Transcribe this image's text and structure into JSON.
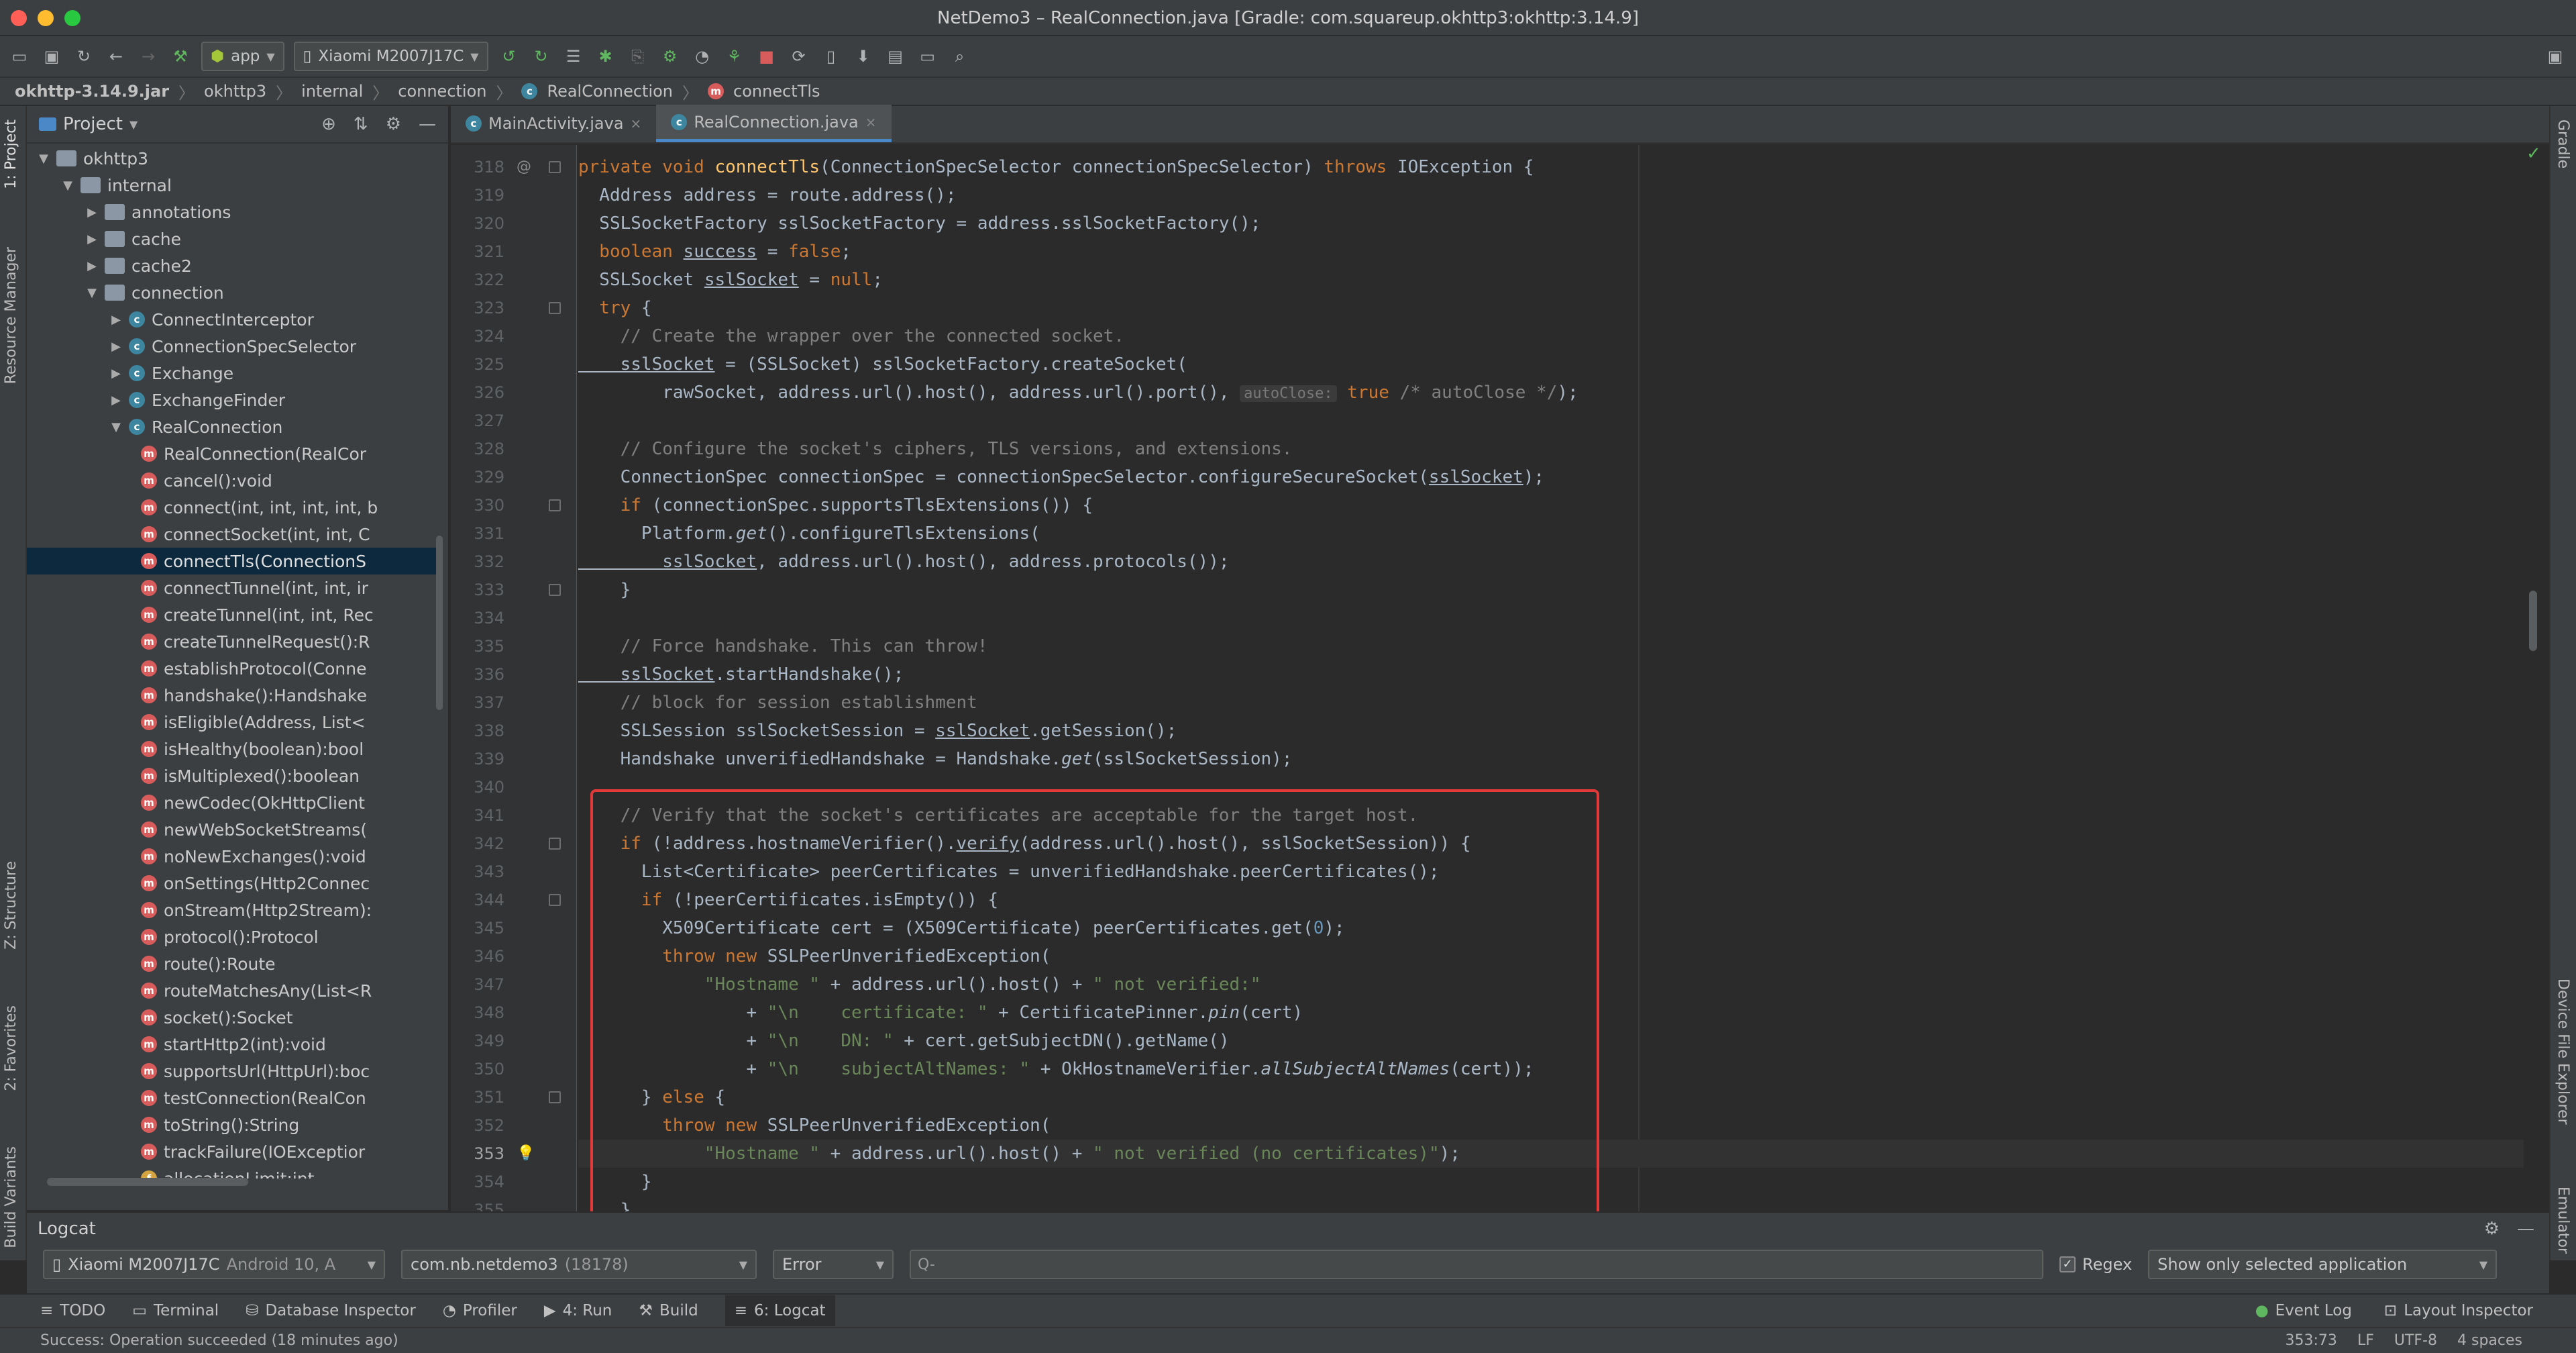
{
  "window": {
    "title": "NetDemo3 – RealConnection.java [Gradle: com.squareup.okhttp3:okhttp:3.14.9]",
    "colors": {
      "close": "#ff5f57",
      "minimize": "#febc2e",
      "maximize": "#28c840",
      "selection_box": "#e23a3a"
    }
  },
  "toolbar": {
    "run_config": "app",
    "device": "Xiaomi M2007J17C"
  },
  "breadcrumb": [
    "okhttp-3.14.9.jar",
    "okhttp3",
    "internal",
    "connection",
    "RealConnection",
    "connectTls"
  ],
  "project": {
    "title": "Project",
    "tree": [
      {
        "label": "okhttp3",
        "kind": "folder",
        "level": 1,
        "expanded": true
      },
      {
        "label": "internal",
        "kind": "folder",
        "level": 2,
        "expanded": true
      },
      {
        "label": "annotations",
        "kind": "folder",
        "level": 3,
        "expanded": false
      },
      {
        "label": "cache",
        "kind": "folder",
        "level": 3,
        "expanded": false
      },
      {
        "label": "cache2",
        "kind": "folder",
        "level": 3,
        "expanded": false
      },
      {
        "label": "connection",
        "kind": "folder",
        "level": 3,
        "expanded": true
      },
      {
        "label": "ConnectInterceptor",
        "kind": "class",
        "level": 4,
        "expanded": false
      },
      {
        "label": "ConnectionSpecSelector",
        "kind": "class",
        "level": 4,
        "expanded": false
      },
      {
        "label": "Exchange",
        "kind": "class",
        "level": 4,
        "expanded": false
      },
      {
        "label": "ExchangeFinder",
        "kind": "class",
        "level": 4,
        "expanded": false
      },
      {
        "label": "RealConnection",
        "kind": "class",
        "level": 4,
        "expanded": true
      },
      {
        "label": "RealConnection(RealCor",
        "kind": "method",
        "level": 5
      },
      {
        "label": "cancel():void",
        "kind": "method",
        "level": 5
      },
      {
        "label": "connect(int, int, int, int, b",
        "kind": "method",
        "level": 5
      },
      {
        "label": "connectSocket(int, int, C",
        "kind": "method",
        "level": 5
      },
      {
        "label": "connectTls(ConnectionS",
        "kind": "method",
        "level": 5,
        "selected": true
      },
      {
        "label": "connectTunnel(int, int, ir",
        "kind": "method",
        "level": 5
      },
      {
        "label": "createTunnel(int, int, Rec",
        "kind": "method",
        "level": 5
      },
      {
        "label": "createTunnelRequest():R",
        "kind": "method",
        "level": 5
      },
      {
        "label": "establishProtocol(Conne",
        "kind": "method",
        "level": 5
      },
      {
        "label": "handshake():Handshake",
        "kind": "method",
        "level": 5
      },
      {
        "label": "isEligible(Address, List<",
        "kind": "method",
        "level": 5
      },
      {
        "label": "isHealthy(boolean):bool",
        "kind": "method",
        "level": 5
      },
      {
        "label": "isMultiplexed():boolean",
        "kind": "method",
        "level": 5
      },
      {
        "label": "newCodec(OkHttpClient",
        "kind": "method",
        "level": 5
      },
      {
        "label": "newWebSocketStreams(",
        "kind": "method",
        "level": 5
      },
      {
        "label": "noNewExchanges():void",
        "kind": "method",
        "level": 5
      },
      {
        "label": "onSettings(Http2Connec",
        "kind": "method",
        "level": 5
      },
      {
        "label": "onStream(Http2Stream):",
        "kind": "method",
        "level": 5
      },
      {
        "label": "protocol():Protocol",
        "kind": "method",
        "level": 5
      },
      {
        "label": "route():Route",
        "kind": "method",
        "level": 5
      },
      {
        "label": "routeMatchesAny(List<R",
        "kind": "method",
        "level": 5
      },
      {
        "label": "socket():Socket",
        "kind": "method",
        "level": 5
      },
      {
        "label": "startHttp2(int):void",
        "kind": "method",
        "level": 5
      },
      {
        "label": "supportsUrl(HttpUrl):boc",
        "kind": "method",
        "level": 5
      },
      {
        "label": "testConnection(RealCon",
        "kind": "method",
        "level": 5
      },
      {
        "label": "toString():String",
        "kind": "method",
        "level": 5
      },
      {
        "label": "trackFailure(IOExceptior",
        "kind": "method",
        "level": 5
      },
      {
        "label": "allocationLimit:int",
        "kind": "field",
        "level": 5
      }
    ]
  },
  "editor": {
    "tabs": [
      {
        "label": "MainActivity.java",
        "active": false
      },
      {
        "label": "RealConnection.java",
        "active": true
      }
    ],
    "current_line": "353",
    "lines": [
      {
        "n": "318",
        "t": [
          [
            "kw",
            "private void "
          ],
          [
            "fn",
            "connectTls"
          ],
          [
            "",
            "(ConnectionSpecSelector connectionSpecSelector) "
          ],
          [
            "kw",
            "throws "
          ],
          [
            "",
            "IOException {"
          ]
        ],
        "mark": "@",
        "fold": true
      },
      {
        "n": "319",
        "t": [
          [
            "",
            "  Address address = route.address();"
          ]
        ]
      },
      {
        "n": "320",
        "t": [
          [
            "",
            "  SSLSocketFactory sslSocketFactory = address.sslSocketFactory();"
          ]
        ]
      },
      {
        "n": "321",
        "t": [
          [
            "kw",
            "  boolean "
          ],
          [
            "ul",
            "success"
          ],
          [
            "",
            " = "
          ],
          [
            "kw",
            "false"
          ],
          [
            "",
            ";"
          ]
        ]
      },
      {
        "n": "322",
        "t": [
          [
            "",
            "  SSLSocket "
          ],
          [
            "ul",
            "sslSocket"
          ],
          [
            "",
            " = "
          ],
          [
            "kw",
            "null"
          ],
          [
            "",
            ";"
          ]
        ]
      },
      {
        "n": "323",
        "t": [
          [
            "kw",
            "  try "
          ],
          [
            "",
            "{"
          ]
        ],
        "fold": true
      },
      {
        "n": "324",
        "t": [
          [
            "cm",
            "    // Create the wrapper over the connected socket."
          ]
        ]
      },
      {
        "n": "325",
        "t": [
          [
            "ul",
            "    sslSocket"
          ],
          [
            "",
            " = (SSLSocket) sslSocketFactory.createSocket("
          ]
        ]
      },
      {
        "n": "326",
        "t": [
          [
            "",
            "        rawSocket, address.url().host(), address.url().port(), "
          ],
          [
            "hint",
            "autoClose:"
          ],
          [
            "kw",
            " true "
          ],
          [
            "cm",
            "/* autoClose */"
          ],
          [
            "",
            ");"
          ]
        ]
      },
      {
        "n": "327",
        "t": [
          [
            "",
            ""
          ]
        ]
      },
      {
        "n": "328",
        "t": [
          [
            "cm",
            "    // Configure the socket's ciphers, TLS versions, and extensions."
          ]
        ]
      },
      {
        "n": "329",
        "t": [
          [
            "",
            "    ConnectionSpec connectionSpec = connectionSpecSelector.configureSecureSocket("
          ],
          [
            "ul",
            "sslSocket"
          ],
          [
            "",
            ");"
          ]
        ]
      },
      {
        "n": "330",
        "t": [
          [
            "kw",
            "    if "
          ],
          [
            "",
            "(connectionSpec.supportsTlsExtensions()) {"
          ]
        ],
        "fold": true
      },
      {
        "n": "331",
        "t": [
          [
            "",
            "      Platform."
          ],
          [
            "it",
            "get"
          ],
          [
            "",
            "().configureTlsExtensions("
          ]
        ]
      },
      {
        "n": "332",
        "t": [
          [
            "ul",
            "        sslSocket"
          ],
          [
            "",
            ", address.url().host(), address.protocols());"
          ]
        ]
      },
      {
        "n": "333",
        "t": [
          [
            "",
            "    }"
          ]
        ],
        "fold": true
      },
      {
        "n": "334",
        "t": [
          [
            "",
            ""
          ]
        ]
      },
      {
        "n": "335",
        "t": [
          [
            "cm",
            "    // Force handshake. This can throw!"
          ]
        ]
      },
      {
        "n": "336",
        "t": [
          [
            "ul",
            "    sslSocket"
          ],
          [
            "",
            ".startHandshake();"
          ]
        ]
      },
      {
        "n": "337",
        "t": [
          [
            "cm",
            "    // block for session establishment"
          ]
        ]
      },
      {
        "n": "338",
        "t": [
          [
            "",
            "    SSLSession sslSocketSession = "
          ],
          [
            "ul",
            "sslSocket"
          ],
          [
            "",
            ".getSession();"
          ]
        ]
      },
      {
        "n": "339",
        "t": [
          [
            "",
            "    Handshake unverifiedHandshake = Handshake."
          ],
          [
            "it",
            "get"
          ],
          [
            "",
            "(sslSocketSession);"
          ]
        ]
      },
      {
        "n": "340",
        "t": [
          [
            "",
            ""
          ]
        ]
      },
      {
        "n": "341",
        "t": [
          [
            "cm",
            "    // Verify that the socket's certificates are acceptable for the target host."
          ]
        ]
      },
      {
        "n": "342",
        "t": [
          [
            "kw",
            "    if "
          ],
          [
            "",
            "(!address.hostnameVerifier()."
          ],
          [
            "ul",
            "verify"
          ],
          [
            "",
            "(address.url().host(), sslSocketSession)) {"
          ]
        ],
        "fold": true
      },
      {
        "n": "343",
        "t": [
          [
            "",
            "      List<Certificate> peerCertificates = unverifiedHandshake.peerCertificates();"
          ]
        ]
      },
      {
        "n": "344",
        "t": [
          [
            "kw",
            "      if "
          ],
          [
            "",
            "(!peerCertificates.isEmpty()) {"
          ]
        ],
        "fold": true
      },
      {
        "n": "345",
        "t": [
          [
            "",
            "        X509Certificate cert = (X509Certificate) peerCertificates.get("
          ],
          [
            "num",
            "0"
          ],
          [
            "",
            ");"
          ]
        ]
      },
      {
        "n": "346",
        "t": [
          [
            "kw",
            "        throw new "
          ],
          [
            "",
            "SSLPeerUnverifiedException("
          ]
        ]
      },
      {
        "n": "347",
        "t": [
          [
            "str",
            "            \"Hostname \""
          ],
          [
            "",
            " + address.url().host() + "
          ],
          [
            "str",
            "\" not verified:\""
          ]
        ]
      },
      {
        "n": "348",
        "t": [
          [
            "",
            "                + "
          ],
          [
            "str",
            "\"\\n    certificate: \""
          ],
          [
            "",
            " + CertificatePinner."
          ],
          [
            "it",
            "pin"
          ],
          [
            "",
            "(cert)"
          ]
        ]
      },
      {
        "n": "349",
        "t": [
          [
            "",
            "                + "
          ],
          [
            "str",
            "\"\\n    DN: \""
          ],
          [
            "",
            " + cert.getSubjectDN().getName()"
          ]
        ]
      },
      {
        "n": "350",
        "t": [
          [
            "",
            "                + "
          ],
          [
            "str",
            "\"\\n    subjectAltNames: \""
          ],
          [
            "",
            " + OkHostnameVerifier."
          ],
          [
            "it",
            "allSubjectAltNames"
          ],
          [
            "",
            "(cert));"
          ]
        ]
      },
      {
        "n": "351",
        "t": [
          [
            "",
            "      } "
          ],
          [
            "kw",
            "else "
          ],
          [
            "",
            "{"
          ]
        ],
        "fold": true
      },
      {
        "n": "352",
        "t": [
          [
            "kw",
            "        throw new "
          ],
          [
            "",
            "SSLPeerUnverifiedException("
          ]
        ]
      },
      {
        "n": "353",
        "t": [
          [
            "str",
            "            \"Hostname \""
          ],
          [
            "",
            " + address.url().host() + "
          ],
          [
            "str",
            "\" not verified (no certificates)\""
          ],
          [
            "",
            ");"
          ]
        ],
        "mark": "💡",
        "current": true
      },
      {
        "n": "354",
        "t": [
          [
            "",
            "      }"
          ]
        ]
      },
      {
        "n": "355",
        "t": [
          [
            "",
            "    }"
          ]
        ]
      }
    ]
  },
  "side_labels": {
    "left": [
      "1: Project",
      "Resource Manager",
      "Z: Structure",
      "2: Favorites",
      "Build Variants"
    ],
    "right": [
      "Gradle",
      "Device File Explorer",
      "Emulator"
    ]
  },
  "logcat": {
    "title": "Logcat",
    "device": "Xiaomi M2007J17C",
    "device_suffix": "Android 10, A",
    "process": "com.nb.netdemo3",
    "process_pid": "(18178)",
    "level": "Error",
    "search_placeholder": "Q-",
    "regex_label": "Regex",
    "filter": "Show only selected application"
  },
  "tool_windows": {
    "left": [
      {
        "icon": "≡",
        "label": "TODO"
      },
      {
        "icon": "▭",
        "label": "Terminal"
      },
      {
        "icon": "⛁",
        "label": "Database Inspector"
      },
      {
        "icon": "◔",
        "label": "Profiler"
      },
      {
        "icon": "▶",
        "label": "4: Run"
      },
      {
        "icon": "⚒",
        "label": "Build"
      },
      {
        "icon": "≡",
        "label": "6: Logcat",
        "active": true
      }
    ],
    "right": [
      {
        "icon": "●",
        "label": "Event Log"
      },
      {
        "icon": "⊡",
        "label": "Layout Inspector"
      }
    ]
  },
  "status": {
    "message": "Success: Operation succeeded (18 minutes ago)",
    "position": "353:73",
    "line_sep": "LF",
    "encoding": "UTF-8",
    "indent": "4 spaces"
  }
}
